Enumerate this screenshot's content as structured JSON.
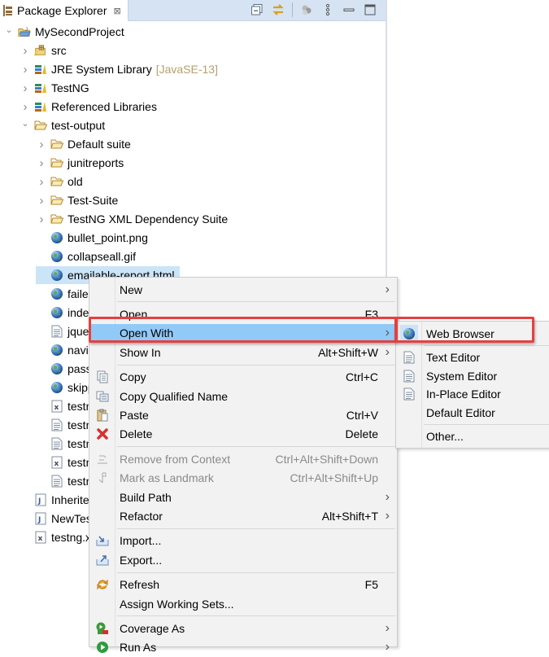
{
  "panel": {
    "title": "Package Explorer",
    "close_glyph": "⊠",
    "toolbar": [
      {
        "name": "collapse-all-icon"
      },
      {
        "name": "link-with-editor-icon"
      },
      {
        "name": "filter-icon"
      },
      {
        "name": "view-menu-icon"
      },
      {
        "name": "minimize-icon"
      },
      {
        "name": "maximize-icon"
      }
    ]
  },
  "tree": [
    {
      "label": "MySecondProject",
      "level": 0,
      "expander": "expanded",
      "icon": "project"
    },
    {
      "label": "src",
      "level": 1,
      "expander": "collapsed",
      "icon": "package-root"
    },
    {
      "label": "JRE System Library",
      "decoration": "[JavaSE-13]",
      "level": 1,
      "expander": "collapsed",
      "icon": "library"
    },
    {
      "label": "TestNG",
      "level": 1,
      "expander": "collapsed",
      "icon": "library"
    },
    {
      "label": "Referenced Libraries",
      "level": 1,
      "expander": "collapsed",
      "icon": "library"
    },
    {
      "label": "test-output",
      "level": 1,
      "expander": "expanded",
      "icon": "folder"
    },
    {
      "label": "Default suite",
      "level": 2,
      "expander": "collapsed",
      "icon": "folder"
    },
    {
      "label": "junitreports",
      "level": 2,
      "expander": "collapsed",
      "icon": "folder"
    },
    {
      "label": "old",
      "level": 2,
      "expander": "collapsed",
      "icon": "folder"
    },
    {
      "label": "Test-Suite",
      "level": 2,
      "expander": "collapsed",
      "icon": "folder"
    },
    {
      "label": "TestNG XML Dependency Suite",
      "level": 2,
      "expander": "collapsed",
      "icon": "folder"
    },
    {
      "label": "bullet_point.png",
      "level": 2,
      "icon": "globe"
    },
    {
      "label": "collapseall.gif",
      "level": 2,
      "icon": "globe"
    },
    {
      "label": "emailable-report.html",
      "level": 2,
      "icon": "globe",
      "selected": true
    },
    {
      "label": "failed.png",
      "level": 2,
      "icon": "globe"
    },
    {
      "label": "index.html",
      "level": 2,
      "icon": "globe"
    },
    {
      "label": "jquery.min.js",
      "level": 2,
      "icon": "text-file"
    },
    {
      "label": "navigator-bullet.png",
      "level": 2,
      "icon": "globe"
    },
    {
      "label": "passed.png",
      "level": 2,
      "icon": "globe"
    },
    {
      "label": "skipped.png",
      "level": 2,
      "icon": "globe"
    },
    {
      "label": "testng-failed.xml",
      "level": 2,
      "icon": "xml-file"
    },
    {
      "label": "testng-results.xml",
      "level": 2,
      "icon": "text-file"
    },
    {
      "label": "testng.css",
      "level": 2,
      "icon": "text-file"
    },
    {
      "label": "testng-reports.xml",
      "level": 2,
      "icon": "xml-file"
    },
    {
      "label": "testng-reports.js",
      "level": 2,
      "icon": "text-file"
    },
    {
      "label": "InheritedTest.java",
      "level": 1,
      "icon": "java-file"
    },
    {
      "label": "NewTest.java",
      "level": 1,
      "icon": "java-file"
    },
    {
      "label": "testng.xml",
      "level": 1,
      "icon": "xml-file"
    }
  ],
  "context_menu": {
    "items": [
      {
        "label": "New",
        "submenu": true
      },
      {
        "sep": true
      },
      {
        "label": "Open",
        "accel": "F3"
      },
      {
        "label": "Open With",
        "submenu": true,
        "highlighted": true
      },
      {
        "label": "Show In",
        "accel": "Alt+Shift+W",
        "submenu": true
      },
      {
        "sep": true
      },
      {
        "label": "Copy",
        "accel": "Ctrl+C",
        "icon": "copy"
      },
      {
        "label": "Copy Qualified Name",
        "icon": "copy-qualified"
      },
      {
        "label": "Paste",
        "accel": "Ctrl+V",
        "icon": "paste"
      },
      {
        "label": "Delete",
        "accel": "Delete",
        "icon": "delete"
      },
      {
        "sep": true
      },
      {
        "label": "Remove from Context",
        "accel": "Ctrl+Alt+Shift+Down",
        "icon": "remove-context",
        "disabled": true
      },
      {
        "label": "Mark as Landmark",
        "accel": "Ctrl+Alt+Shift+Up",
        "icon": "landmark",
        "disabled": true
      },
      {
        "label": "Build Path",
        "submenu": true
      },
      {
        "label": "Refactor",
        "accel": "Alt+Shift+T",
        "submenu": true
      },
      {
        "sep": true
      },
      {
        "label": "Import...",
        "icon": "import"
      },
      {
        "label": "Export...",
        "icon": "export"
      },
      {
        "sep": true
      },
      {
        "label": "Refresh",
        "accel": "F5",
        "icon": "refresh"
      },
      {
        "label": "Assign Working Sets..."
      },
      {
        "sep": true
      },
      {
        "label": "Coverage As",
        "submenu": true,
        "icon": "coverage"
      },
      {
        "label": "Run As",
        "submenu": true,
        "icon": "run"
      }
    ]
  },
  "open_with_menu": {
    "items": [
      {
        "label": "Web Browser",
        "icon": "globe",
        "selected": true
      },
      {
        "sep": true
      },
      {
        "label": "Text Editor",
        "icon": "text-file"
      },
      {
        "label": "System Editor",
        "icon": "text-file"
      },
      {
        "label": "In-Place Editor",
        "icon": "text-file"
      },
      {
        "label": "Default Editor"
      },
      {
        "sep": true
      },
      {
        "label": "Other..."
      }
    ]
  },
  "colors": {
    "menu_highlight": "#91c9f7",
    "annotation_box": "#e64040",
    "selection": "#cce4f7",
    "header_bg": "#d6e3f2"
  }
}
